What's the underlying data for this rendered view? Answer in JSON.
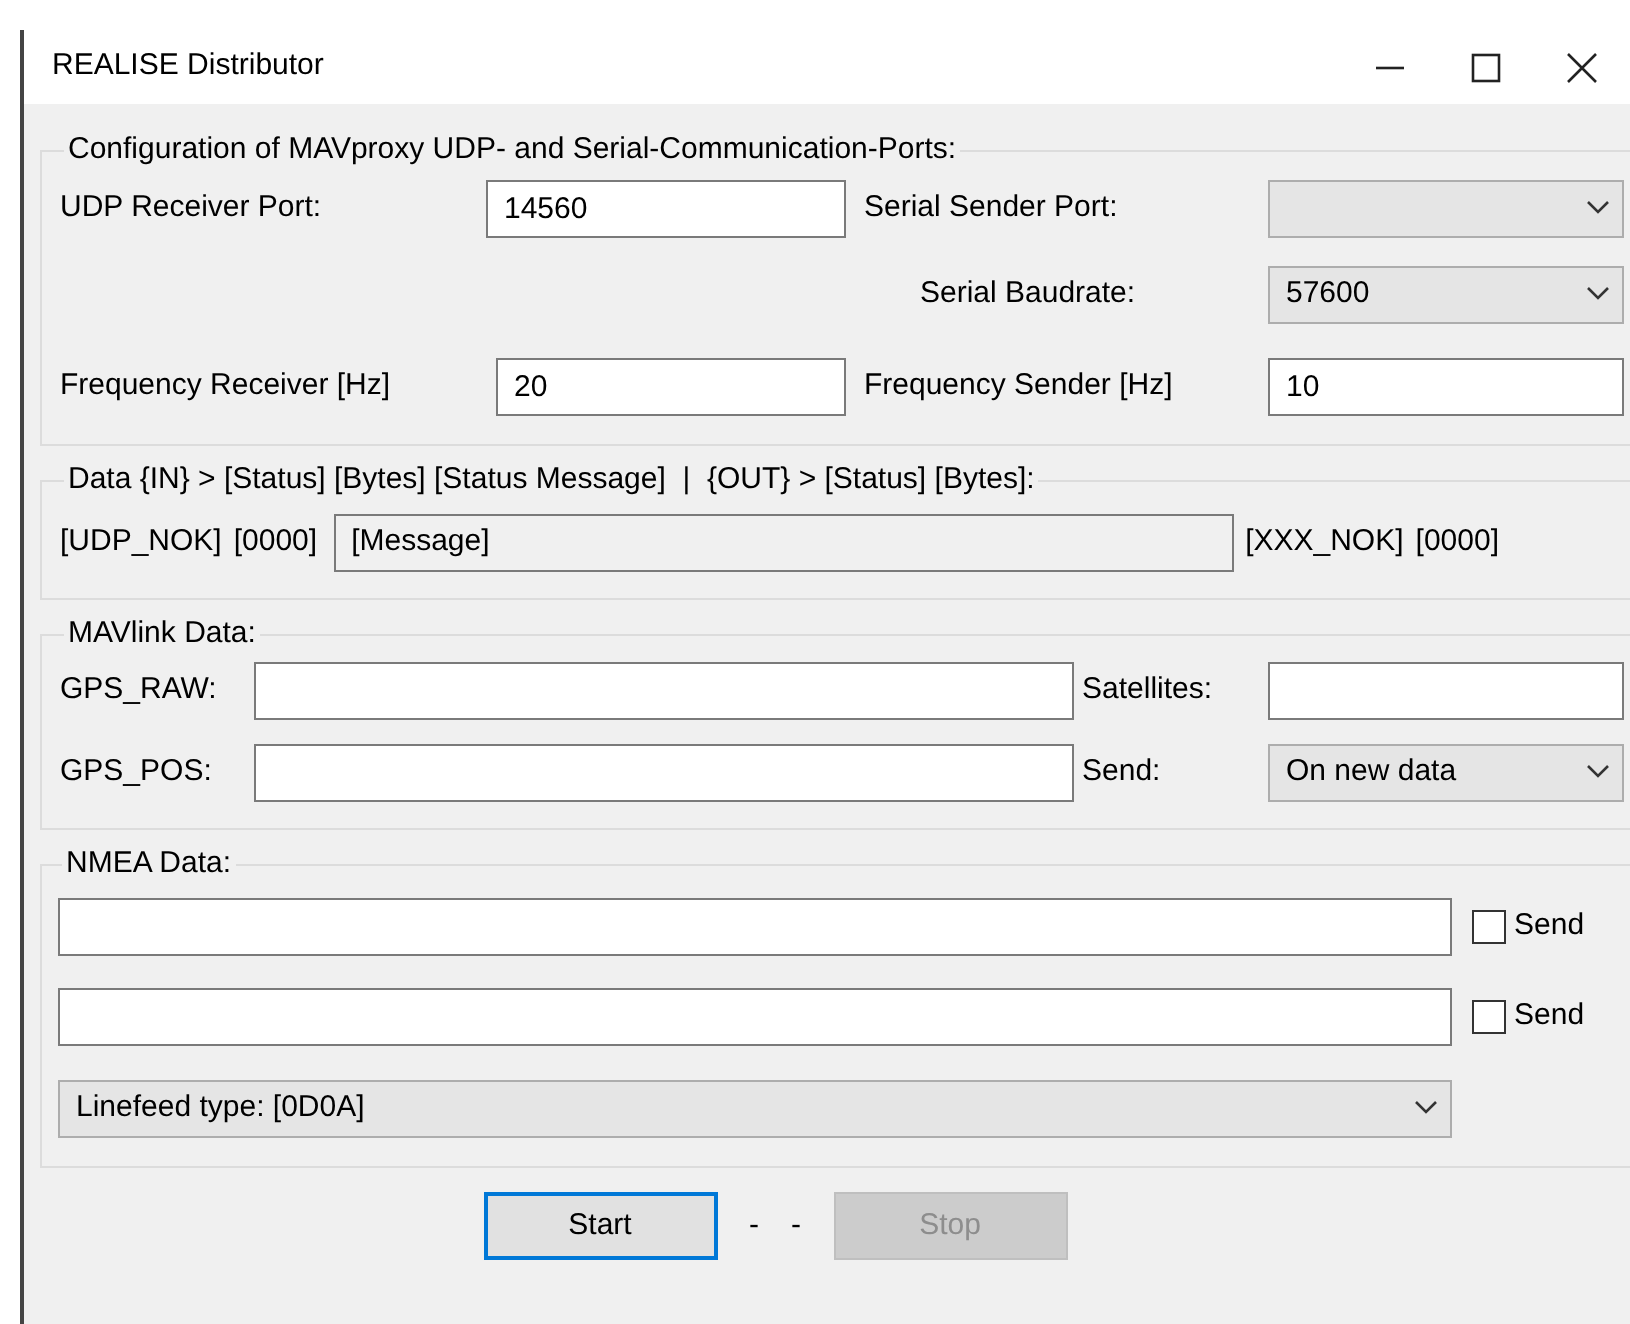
{
  "window": {
    "title": "REALISE Distributor"
  },
  "ports": {
    "legend": "Configuration of MAVproxy UDP- and Serial-Communication-Ports:",
    "udp_receiver_port": {
      "label": "UDP Receiver Port:",
      "value": "14560"
    },
    "serial_sender_port": {
      "label": "Serial Sender Port:"
    },
    "serial_baudrate": {
      "label": "Serial Baudrate:",
      "value": "57600"
    },
    "frequency_receiver": {
      "label": "Frequency Receiver [Hz]",
      "value": "20"
    },
    "frequency_sender": {
      "label": "Frequency Sender [Hz]",
      "value": "10"
    }
  },
  "data": {
    "legend": "Data {IN} > [Status] [Bytes] [Status Message]  |  {OUT} > [Status] [Bytes]:",
    "in_status": "[UDP_NOK]",
    "in_bytes": "[0000]",
    "message": "[Message]",
    "out_status": "[XXX_NOK]",
    "out_bytes": "[0000]"
  },
  "mavlink": {
    "legend": "MAVlink Data:",
    "gps_raw": {
      "label": "GPS_RAW:"
    },
    "satellites": {
      "label": "Satellites:"
    },
    "gps_pos": {
      "label": "GPS_POS:"
    },
    "send": {
      "label": "Send:",
      "value": "On new data"
    }
  },
  "nmea": {
    "legend": "NMEA Data:",
    "lines": [
      {
        "checkbox_label": "Send",
        "checked": false
      },
      {
        "checkbox_label": "Send",
        "checked": false
      }
    ],
    "linefeed": {
      "value": "Linefeed type: [0D0A]"
    }
  },
  "buttons": [
    {
      "label": "Start",
      "disabled": false,
      "default": true
    },
    {
      "label": "Stop",
      "disabled": true,
      "default": false
    }
  ],
  "separators": [
    "-",
    "-"
  ]
}
